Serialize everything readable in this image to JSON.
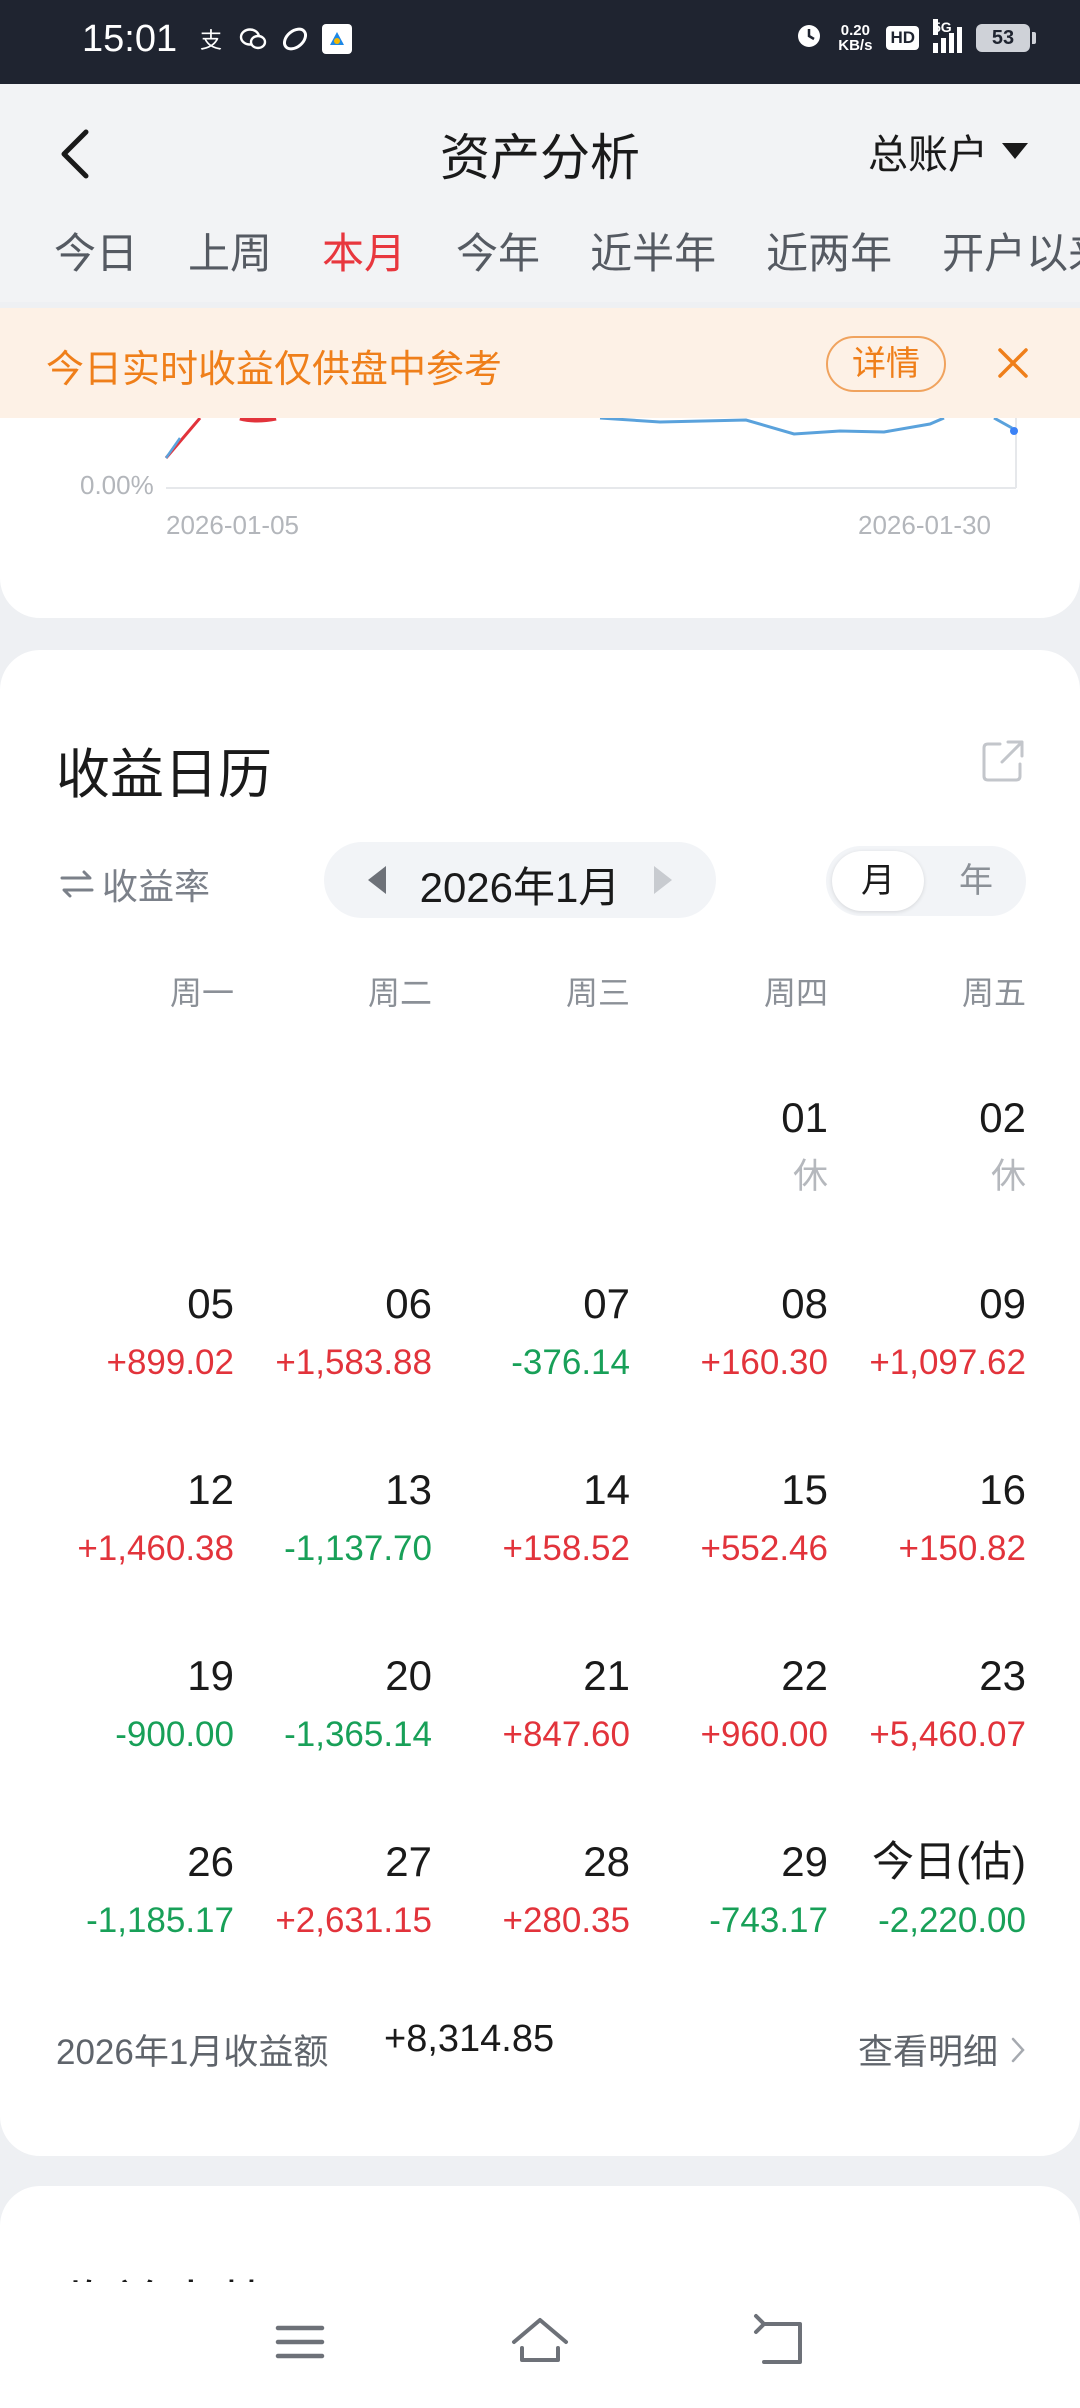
{
  "status_bar": {
    "time": "15:01",
    "net_speed_value": "0.20",
    "net_speed_unit": "KB/s",
    "hd": "HD",
    "network": "5G",
    "battery": "53"
  },
  "header": {
    "title": "资产分析",
    "account_label": "总账户",
    "tabs": [
      {
        "label": "今日",
        "active": false
      },
      {
        "label": "上周",
        "active": false
      },
      {
        "label": "本月",
        "active": true
      },
      {
        "label": "今年",
        "active": false
      },
      {
        "label": "近半年",
        "active": false
      },
      {
        "label": "近两年",
        "active": false
      },
      {
        "label": "开户以来",
        "active": false
      }
    ]
  },
  "notice": {
    "text": "今日实时收益仅供盘中参考",
    "button": "详情"
  },
  "chart": {
    "y_label": "0.00%",
    "x_start": "2026-01-05",
    "x_end": "2026-01-30",
    "colors": {
      "line_up": "#e2333b",
      "line_main": "#5aa2dc"
    }
  },
  "calendar": {
    "title": "收益日历",
    "toggle_label": "收益率",
    "month_label": "2026年1月",
    "seg_month": "月",
    "seg_year": "年",
    "weekdays": [
      "周一",
      "周二",
      "周三",
      "周四",
      "周五"
    ],
    "rows": [
      [
        {
          "day": "",
          "value": "",
          "kind": ""
        },
        {
          "day": "",
          "value": "",
          "kind": ""
        },
        {
          "day": "",
          "value": "",
          "kind": ""
        },
        {
          "day": "01",
          "value": "休",
          "kind": "rest"
        },
        {
          "day": "02",
          "value": "休",
          "kind": "rest"
        }
      ],
      [
        {
          "day": "05",
          "value": "+899.02",
          "kind": "pos"
        },
        {
          "day": "06",
          "value": "+1,583.88",
          "kind": "pos"
        },
        {
          "day": "07",
          "value": "-376.14",
          "kind": "neg"
        },
        {
          "day": "08",
          "value": "+160.30",
          "kind": "pos"
        },
        {
          "day": "09",
          "value": "+1,097.62",
          "kind": "pos"
        }
      ],
      [
        {
          "day": "12",
          "value": "+1,460.38",
          "kind": "pos"
        },
        {
          "day": "13",
          "value": "-1,137.70",
          "kind": "neg"
        },
        {
          "day": "14",
          "value": "+158.52",
          "kind": "pos"
        },
        {
          "day": "15",
          "value": "+552.46",
          "kind": "pos"
        },
        {
          "day": "16",
          "value": "+150.82",
          "kind": "pos"
        }
      ],
      [
        {
          "day": "19",
          "value": "-900.00",
          "kind": "neg"
        },
        {
          "day": "20",
          "value": "-1,365.14",
          "kind": "neg"
        },
        {
          "day": "21",
          "value": "+847.60",
          "kind": "pos"
        },
        {
          "day": "22",
          "value": "+960.00",
          "kind": "pos"
        },
        {
          "day": "23",
          "value": "+5,460.07",
          "kind": "pos"
        }
      ],
      [
        {
          "day": "26",
          "value": "-1,185.17",
          "kind": "neg"
        },
        {
          "day": "27",
          "value": "+2,631.15",
          "kind": "pos"
        },
        {
          "day": "28",
          "value": "+280.35",
          "kind": "pos"
        },
        {
          "day": "29",
          "value": "-743.17",
          "kind": "neg"
        },
        {
          "day": "今日(估)",
          "value": "-2,220.00",
          "kind": "neg"
        }
      ]
    ],
    "summary_label": "2026年1月收益额",
    "summary_value": "+8,314.85",
    "detail_link": "查看明细"
  },
  "next_section": {
    "title": "收益走势"
  }
}
